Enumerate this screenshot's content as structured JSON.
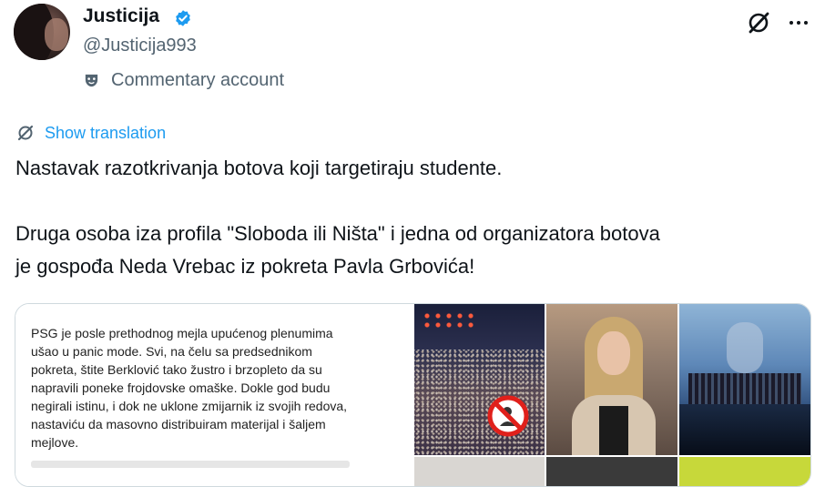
{
  "author": {
    "display_name": "Justicija",
    "handle": "@Justicija993",
    "label": "Commentary account",
    "verified": true,
    "verified_color": "#1d9bf0"
  },
  "header_actions": {
    "grok_icon": "grok-icon",
    "more_icon": "more-options-icon"
  },
  "translate": {
    "label": "Show translation",
    "icon": "grok-icon"
  },
  "tweet": {
    "lines": [
      "Nastavak razotkrivanja botova koji targetiraju studente.",
      "Druga osoba iza profila \"Sloboda ili Ništa\" i jedna od organizatora botova",
      "je gospođa Neda Vrebac iz pokreta Pavla Grbovića!"
    ]
  },
  "media": {
    "document_text": "PSG je posle prethodnog mejla upućenog plenumima\nušao u panic mode. Svi, na čelu sa predsednikom\npokreta, štite Berklović tako žustro i brzopleto da su\nnapravili poneke frojdovske omaške. Dokle god budu\nnegirali istinu, i dok ne uklone zmijarnik iz svojih redova,\nnastaviću da masovno distribuiram materijal i šaljem\nmejlove.",
    "photos": [
      "crowd-protest-photo",
      "woman-portrait-photo",
      "stage-event-photo",
      "photo-4",
      "photo-5",
      "photo-6"
    ]
  },
  "colors": {
    "text_primary": "#0f1419",
    "text_secondary": "#536471",
    "link": "#1d9bf0",
    "border": "#cfd9de"
  }
}
